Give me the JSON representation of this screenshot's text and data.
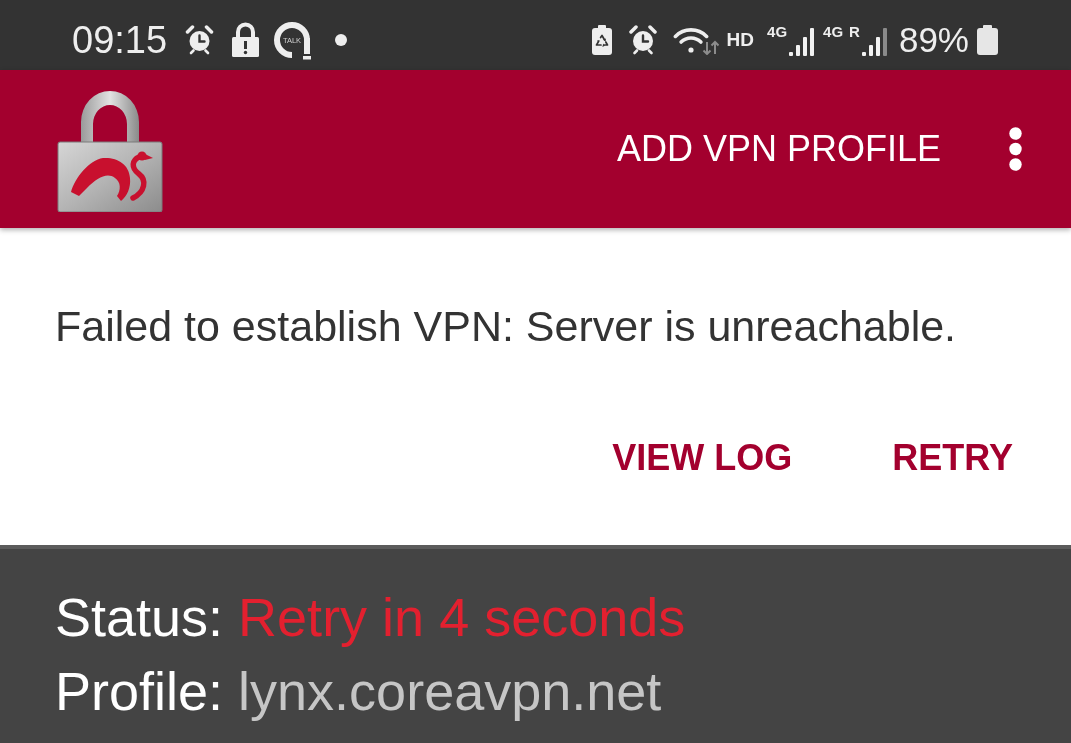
{
  "status_bar": {
    "time": "09:15",
    "app_icon_text": "TALK",
    "wifi_label": "HD",
    "signals": [
      {
        "network": "4G"
      },
      {
        "network": "4G",
        "roaming": "R"
      }
    ],
    "battery": "89%"
  },
  "app_bar": {
    "action": "ADD VPN PROFILE"
  },
  "error_card": {
    "message": "Failed to establish VPN: Server is unreachable.",
    "buttons": [
      "VIEW LOG",
      "RETRY"
    ]
  },
  "status_panel": {
    "rows": [
      {
        "label": "Status:",
        "value": "Retry in 4 seconds",
        "kind": "error"
      },
      {
        "label": "Profile:",
        "value": "lynx.coreavpn.net",
        "kind": "info"
      }
    ]
  }
}
